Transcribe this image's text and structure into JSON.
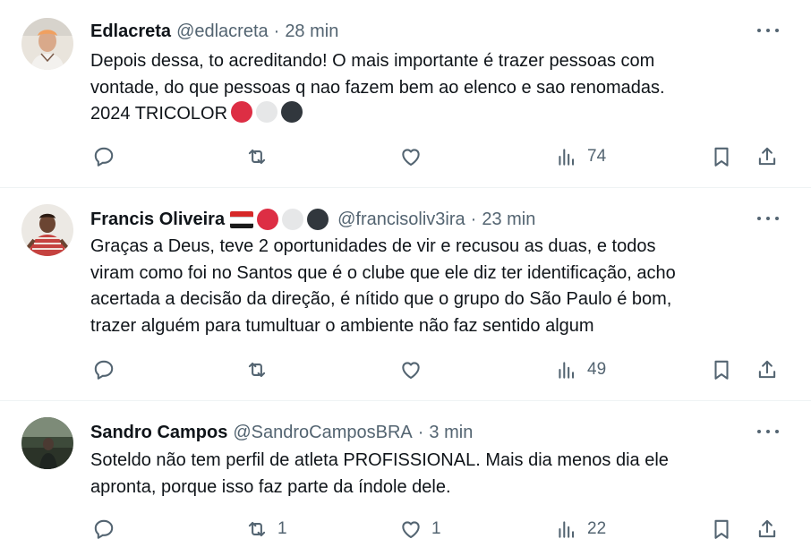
{
  "tweets": [
    {
      "name": "Edlacreta",
      "handle": "@edlacreta",
      "separator": "·",
      "time": "28 min",
      "lines": [
        "Depois dessa, to acreditando! O mais importante é trazer pessoas com",
        "vontade, do que pessoas q nao fazem bem ao elenco e sao renomadas.",
        "2024 TRICOLOR"
      ],
      "trailing_emojis": [
        "red-circle",
        "white-circle",
        "black-circle"
      ],
      "replies": "",
      "reposts": "",
      "likes": "",
      "views": "74"
    },
    {
      "name": "Francis Oliveira",
      "name_emojis": [
        "flag-sao-paulo",
        "red-circle",
        "white-circle",
        "black-circle"
      ],
      "handle": "@francisoliv3ira",
      "separator": "·",
      "time": "23 min",
      "lines": [
        "Graças a Deus, teve 2 oportunidades de vir e recusou as duas, e todos",
        "viram como foi no Santos que é o clube que ele diz ter identificação, acho",
        "acertada a decisão da direção, é nítido que o grupo do São Paulo é bom,",
        "trazer alguém para tumultuar o ambiente não faz sentido algum"
      ],
      "replies": "",
      "reposts": "",
      "likes": "",
      "views": "49"
    },
    {
      "name": "Sandro Campos",
      "handle": "@SandroCamposBRA",
      "separator": "·",
      "time": "3 min",
      "lines": [
        "Soteldo não tem perfil de atleta PROFISSIONAL. Mais dia menos dia ele",
        "apronta, porque isso faz parte da índole dele."
      ],
      "replies": "",
      "reposts": "1",
      "likes": "1",
      "views": "22"
    }
  ],
  "colors": {
    "text": "#0f1419",
    "secondary": "#536471",
    "divider": "#eff3f4"
  },
  "icons": [
    "reply-icon",
    "repost-icon",
    "like-icon",
    "views-icon",
    "bookmark-icon",
    "share-icon",
    "more-icon"
  ]
}
